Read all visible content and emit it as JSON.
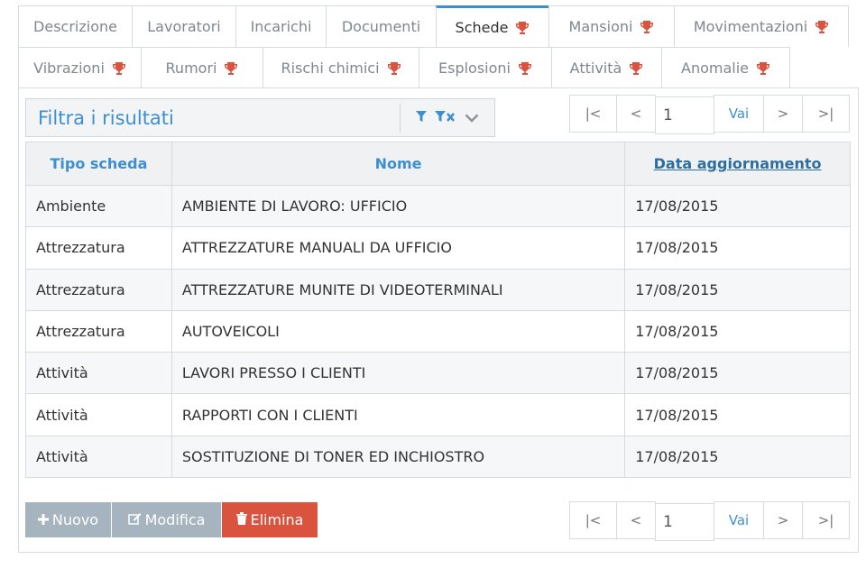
{
  "tabs_row1": [
    {
      "label": "Descrizione",
      "trophy": false
    },
    {
      "label": "Lavoratori",
      "trophy": false
    },
    {
      "label": "Incarichi",
      "trophy": false
    },
    {
      "label": "Documenti",
      "trophy": false
    },
    {
      "label": "Schede",
      "trophy": true,
      "active": true
    },
    {
      "label": "Mansioni",
      "trophy": true
    },
    {
      "label": "Movimentazioni",
      "trophy": true
    }
  ],
  "tabs_row2": [
    {
      "label": "Vibrazioni",
      "trophy": true
    },
    {
      "label": "Rumori",
      "trophy": true
    },
    {
      "label": "Rischi chimici",
      "trophy": true
    },
    {
      "label": "Esplosioni",
      "trophy": true
    },
    {
      "label": "Attività",
      "trophy": true
    },
    {
      "label": "Anomalie",
      "trophy": true
    }
  ],
  "filter": {
    "placeholder": "Filtra i risultati"
  },
  "pager": {
    "first": "|<",
    "prev": "<",
    "page": "1",
    "go": "Vai",
    "next": ">",
    "last": ">|"
  },
  "table": {
    "headers": [
      "Tipo scheda",
      "Nome",
      "Data aggiornamento"
    ],
    "rows": [
      [
        "Ambiente",
        "AMBIENTE DI LAVORO: UFFICIO",
        "17/08/2015"
      ],
      [
        "Attrezzatura",
        "ATTREZZATURE MANUALI DA UFFICIO",
        "17/08/2015"
      ],
      [
        "Attrezzatura",
        "ATTREZZATURE MUNITE DI VIDEOTERMINALI",
        "17/08/2015"
      ],
      [
        "Attrezzatura",
        "AUTOVEICOLI",
        "17/08/2015"
      ],
      [
        "Attività",
        "LAVORI PRESSO I CLIENTI",
        "17/08/2015"
      ],
      [
        "Attività",
        "RAPPORTI CON I CLIENTI",
        "17/08/2015"
      ],
      [
        "Attività",
        "SOSTITUZIONE DI TONER ED INCHIOSTRO",
        "17/08/2015"
      ]
    ]
  },
  "actions": {
    "new": "Nuovo",
    "edit": "Modifica",
    "delete": "Elimina"
  },
  "colors": {
    "accent": "#3d8fd0",
    "trophy": "#d9533f",
    "danger": "#d9533f",
    "muted_button": "#a6b4bf"
  }
}
